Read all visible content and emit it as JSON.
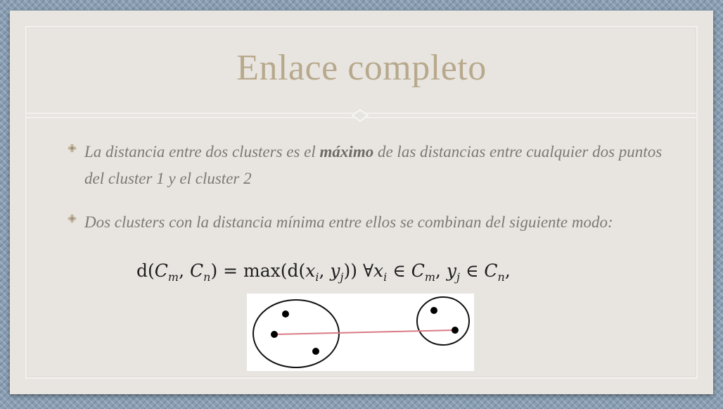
{
  "slide": {
    "title": "Enlace completo",
    "bullets": [
      {
        "before": "La distancia entre dos clusters es el ",
        "emphasis": "máximo",
        "after": " de las distancias entre cualquier dos puntos del cluster 1 y el cluster 2"
      },
      {
        "text": "Dos clusters con la distancia mínima entre ellos se combinan del siguiente modo:"
      }
    ],
    "formula": {
      "d1": "d(",
      "C1": "C",
      "sub_m": "m",
      "comma1": ", ",
      "C2": "C",
      "sub_n": "n",
      "mid": ") = max(d(",
      "x": "x",
      "sub_i": "i",
      "comma2": ", ",
      "y": "y",
      "sub_j": "j",
      "close": ")) ∀",
      "x2": "x",
      "sub_i2": "i",
      "in1": " ∈ ",
      "C3": "C",
      "sub_m2": "m",
      "comma3": ", ",
      "y2": "y",
      "sub_j2": "j",
      "in2": " ∈ ",
      "C4": "C",
      "sub_n2": "n",
      "end": ","
    }
  },
  "colors": {
    "title": "#b8a98d",
    "body_text": "#7c7974",
    "link_line": "#d97a86",
    "points": "#000000"
  }
}
